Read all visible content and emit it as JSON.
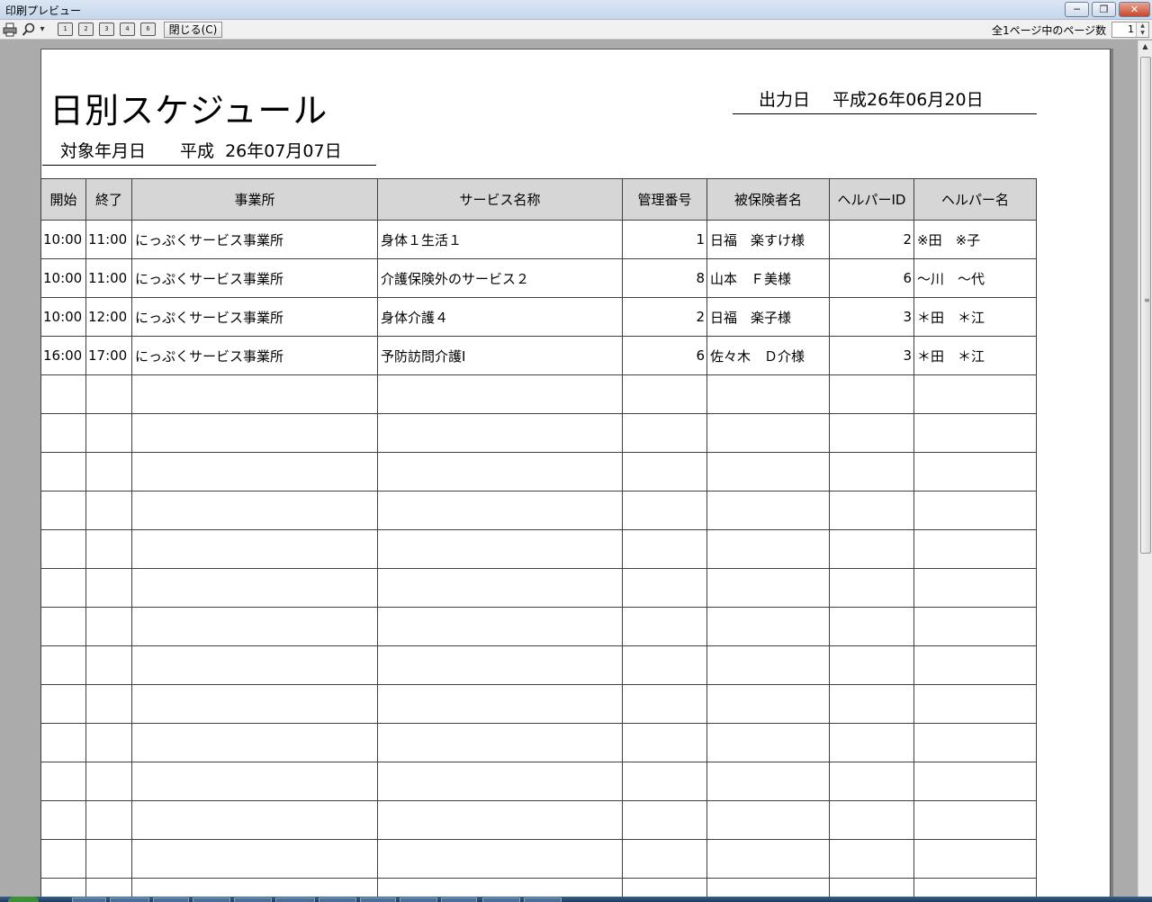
{
  "window": {
    "title": "印刷プレビュー",
    "minimize": "─",
    "maximize": "❐",
    "close": "✕"
  },
  "toolbar": {
    "print_icon": "printer-icon",
    "zoom_icon": "magnifier-icon",
    "dropdown_glyph": "▾",
    "view_buttons": [
      "1",
      "2",
      "3",
      "4",
      "6"
    ],
    "close_label": "閉じる(C)",
    "page_count_label": "全1ページ中のページ数",
    "page_value": "1"
  },
  "document": {
    "title": "日別スケジュール",
    "output_date": "出力日　 平成26年06月20日",
    "target_date": "対象年月日　　平成  26年07月07日"
  },
  "table": {
    "headers": [
      "開始",
      "終了",
      "事業所",
      "サービス名称",
      "管理番号",
      "被保険者名",
      "ヘルパーID",
      "ヘルパー名"
    ],
    "rows": [
      [
        "10:00",
        "11:00",
        "にっぷくサービス事業所",
        "身体１生活１",
        "1",
        "日福　楽すけ様",
        "2",
        "※田　※子"
      ],
      [
        "10:00",
        "11:00",
        "にっぷくサービス事業所",
        "介護保険外のサービス２",
        "8",
        "山本　Ｆ美様",
        "6",
        "～川　～代"
      ],
      [
        "10:00",
        "12:00",
        "にっぷくサービス事業所",
        "身体介護４",
        "2",
        "日福　楽子様",
        "3",
        "＊田　＊江"
      ],
      [
        "16:00",
        "17:00",
        "にっぷくサービス事業所",
        "予防訪問介護Ⅰ",
        "6",
        "佐々木　Ｄ介様",
        "3",
        "＊田　＊江"
      ]
    ],
    "empty_rows": 14
  },
  "colors": {
    "workspace": "#ababab",
    "header_fill": "#d6d6d6",
    "grid_line": "#3f3f3f"
  }
}
